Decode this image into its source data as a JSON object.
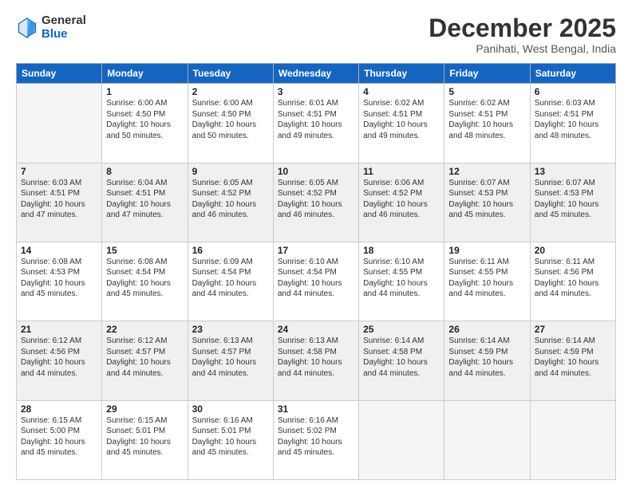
{
  "header": {
    "logo_general": "General",
    "logo_blue": "Blue",
    "month_title": "December 2025",
    "subtitle": "Panihati, West Bengal, India"
  },
  "days_of_week": [
    "Sunday",
    "Monday",
    "Tuesday",
    "Wednesday",
    "Thursday",
    "Friday",
    "Saturday"
  ],
  "weeks": [
    [
      {
        "day": "",
        "info": ""
      },
      {
        "day": "1",
        "info": "Sunrise: 6:00 AM\nSunset: 4:50 PM\nDaylight: 10 hours\nand 50 minutes."
      },
      {
        "day": "2",
        "info": "Sunrise: 6:00 AM\nSunset: 4:50 PM\nDaylight: 10 hours\nand 50 minutes."
      },
      {
        "day": "3",
        "info": "Sunrise: 6:01 AM\nSunset: 4:51 PM\nDaylight: 10 hours\nand 49 minutes."
      },
      {
        "day": "4",
        "info": "Sunrise: 6:02 AM\nSunset: 4:51 PM\nDaylight: 10 hours\nand 49 minutes."
      },
      {
        "day": "5",
        "info": "Sunrise: 6:02 AM\nSunset: 4:51 PM\nDaylight: 10 hours\nand 48 minutes."
      },
      {
        "day": "6",
        "info": "Sunrise: 6:03 AM\nSunset: 4:51 PM\nDaylight: 10 hours\nand 48 minutes."
      }
    ],
    [
      {
        "day": "7",
        "info": "Sunrise: 6:03 AM\nSunset: 4:51 PM\nDaylight: 10 hours\nand 47 minutes."
      },
      {
        "day": "8",
        "info": "Sunrise: 6:04 AM\nSunset: 4:51 PM\nDaylight: 10 hours\nand 47 minutes."
      },
      {
        "day": "9",
        "info": "Sunrise: 6:05 AM\nSunset: 4:52 PM\nDaylight: 10 hours\nand 46 minutes."
      },
      {
        "day": "10",
        "info": "Sunrise: 6:05 AM\nSunset: 4:52 PM\nDaylight: 10 hours\nand 46 minutes."
      },
      {
        "day": "11",
        "info": "Sunrise: 6:06 AM\nSunset: 4:52 PM\nDaylight: 10 hours\nand 46 minutes."
      },
      {
        "day": "12",
        "info": "Sunrise: 6:07 AM\nSunset: 4:53 PM\nDaylight: 10 hours\nand 45 minutes."
      },
      {
        "day": "13",
        "info": "Sunrise: 6:07 AM\nSunset: 4:53 PM\nDaylight: 10 hours\nand 45 minutes."
      }
    ],
    [
      {
        "day": "14",
        "info": "Sunrise: 6:08 AM\nSunset: 4:53 PM\nDaylight: 10 hours\nand 45 minutes."
      },
      {
        "day": "15",
        "info": "Sunrise: 6:08 AM\nSunset: 4:54 PM\nDaylight: 10 hours\nand 45 minutes."
      },
      {
        "day": "16",
        "info": "Sunrise: 6:09 AM\nSunset: 4:54 PM\nDaylight: 10 hours\nand 44 minutes."
      },
      {
        "day": "17",
        "info": "Sunrise: 6:10 AM\nSunset: 4:54 PM\nDaylight: 10 hours\nand 44 minutes."
      },
      {
        "day": "18",
        "info": "Sunrise: 6:10 AM\nSunset: 4:55 PM\nDaylight: 10 hours\nand 44 minutes."
      },
      {
        "day": "19",
        "info": "Sunrise: 6:11 AM\nSunset: 4:55 PM\nDaylight: 10 hours\nand 44 minutes."
      },
      {
        "day": "20",
        "info": "Sunrise: 6:11 AM\nSunset: 4:56 PM\nDaylight: 10 hours\nand 44 minutes."
      }
    ],
    [
      {
        "day": "21",
        "info": "Sunrise: 6:12 AM\nSunset: 4:56 PM\nDaylight: 10 hours\nand 44 minutes."
      },
      {
        "day": "22",
        "info": "Sunrise: 6:12 AM\nSunset: 4:57 PM\nDaylight: 10 hours\nand 44 minutes."
      },
      {
        "day": "23",
        "info": "Sunrise: 6:13 AM\nSunset: 4:57 PM\nDaylight: 10 hours\nand 44 minutes."
      },
      {
        "day": "24",
        "info": "Sunrise: 6:13 AM\nSunset: 4:58 PM\nDaylight: 10 hours\nand 44 minutes."
      },
      {
        "day": "25",
        "info": "Sunrise: 6:14 AM\nSunset: 4:58 PM\nDaylight: 10 hours\nand 44 minutes."
      },
      {
        "day": "26",
        "info": "Sunrise: 6:14 AM\nSunset: 4:59 PM\nDaylight: 10 hours\nand 44 minutes."
      },
      {
        "day": "27",
        "info": "Sunrise: 6:14 AM\nSunset: 4:59 PM\nDaylight: 10 hours\nand 44 minutes."
      }
    ],
    [
      {
        "day": "28",
        "info": "Sunrise: 6:15 AM\nSunset: 5:00 PM\nDaylight: 10 hours\nand 45 minutes."
      },
      {
        "day": "29",
        "info": "Sunrise: 6:15 AM\nSunset: 5:01 PM\nDaylight: 10 hours\nand 45 minutes."
      },
      {
        "day": "30",
        "info": "Sunrise: 6:16 AM\nSunset: 5:01 PM\nDaylight: 10 hours\nand 45 minutes."
      },
      {
        "day": "31",
        "info": "Sunrise: 6:16 AM\nSunset: 5:02 PM\nDaylight: 10 hours\nand 45 minutes."
      },
      {
        "day": "",
        "info": ""
      },
      {
        "day": "",
        "info": ""
      },
      {
        "day": "",
        "info": ""
      }
    ]
  ]
}
